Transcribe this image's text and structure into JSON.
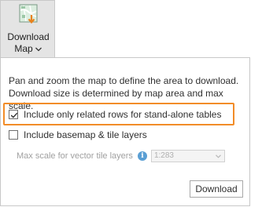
{
  "ribbon": {
    "label_line1": "Download",
    "label_line2": "Map",
    "icon": "download-map-icon"
  },
  "panel": {
    "description": "Pan and zoom the map to define the area to download. Download size is determined by map area and max scale.",
    "options": [
      {
        "label": "Include only related rows for stand-alone tables",
        "checked": true
      },
      {
        "label": "Include basemap & tile layers",
        "checked": false
      }
    ],
    "max_scale_label": "Max scale for vector tile layers",
    "max_scale_value": "1:283",
    "download_button": "Download"
  },
  "colors": {
    "highlight": "#f28c28",
    "info_icon": "#5a9fd4"
  }
}
